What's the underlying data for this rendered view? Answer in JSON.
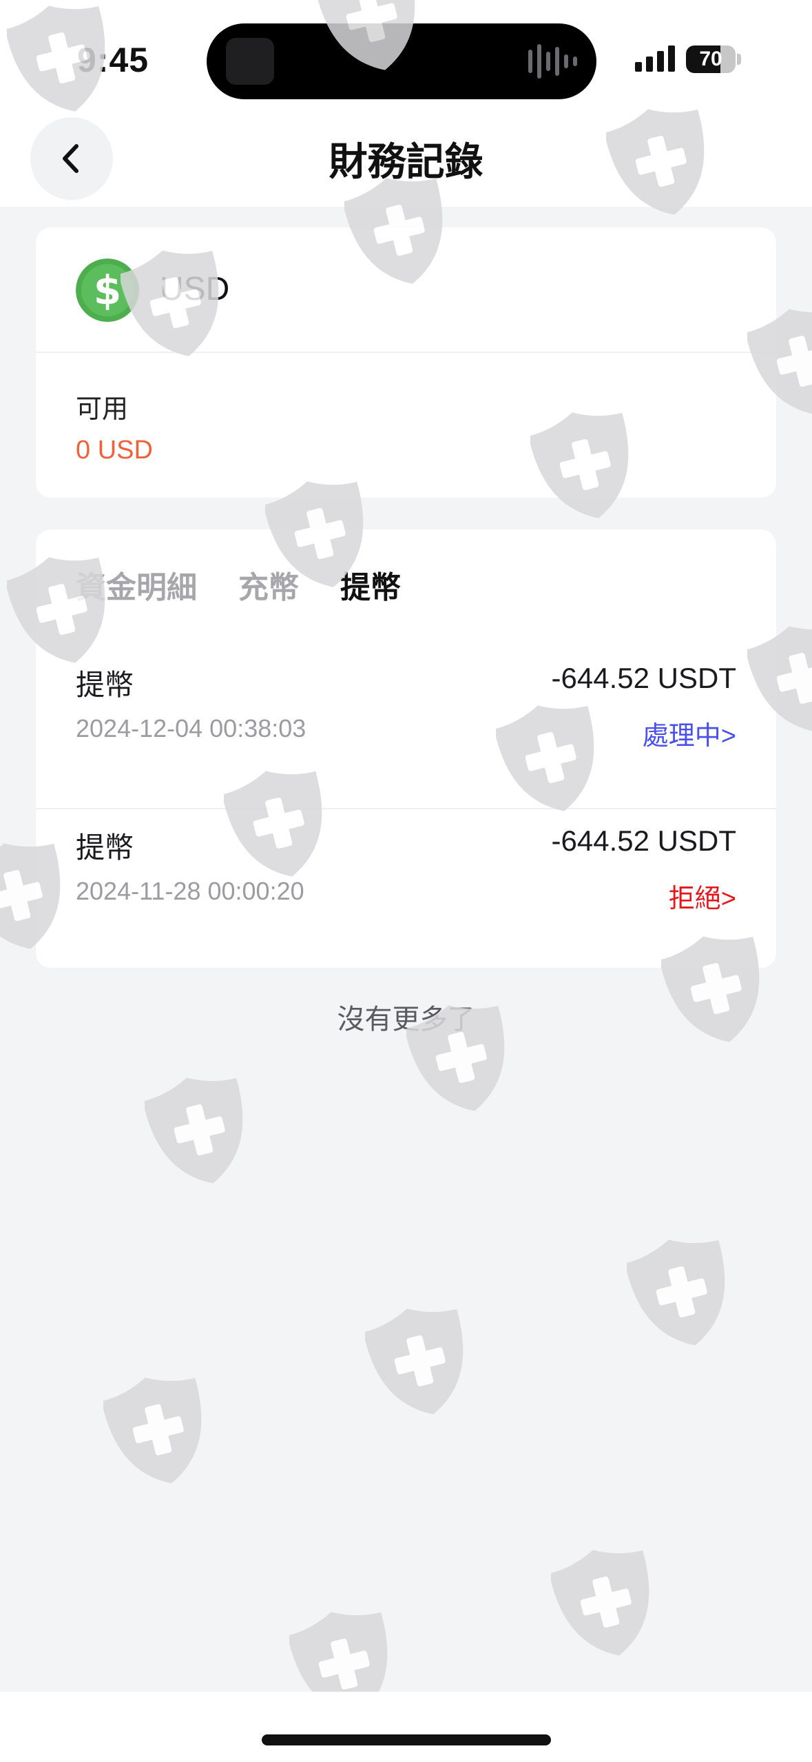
{
  "status_bar": {
    "time": "9:45",
    "battery": "70",
    "battery_level": 0.7
  },
  "header": {
    "title": "財務記錄",
    "back_icon": "chevron-left-icon"
  },
  "balance": {
    "currency": "USD",
    "coin_icon": "dollar-coin-icon",
    "available_label": "可用",
    "available_value": "0 USD"
  },
  "tabs": [
    {
      "label": "資金明細",
      "active": false
    },
    {
      "label": "充幣",
      "active": false
    },
    {
      "label": "提幣",
      "active": true
    }
  ],
  "records": [
    {
      "type": "提幣",
      "datetime": "2024-12-04 00:38:03",
      "amount": "-644.52 USDT",
      "status": "處理中>",
      "status_color": "#4a4ff0"
    },
    {
      "type": "提幣",
      "datetime": "2024-11-28 00:00:20",
      "amount": "-644.52 USDT",
      "status": "拒絕>",
      "status_color": "#e8161b"
    }
  ],
  "footer": {
    "no_more": "沒有更多了"
  },
  "colors": {
    "accent_orange": "#f0613b",
    "processing_blue": "#4a4ff0",
    "rejected_red": "#e8161b",
    "coin_green": "#4cae4c",
    "watermark": "#d8d8da"
  },
  "watermark_icon": "shield-plus-icon"
}
